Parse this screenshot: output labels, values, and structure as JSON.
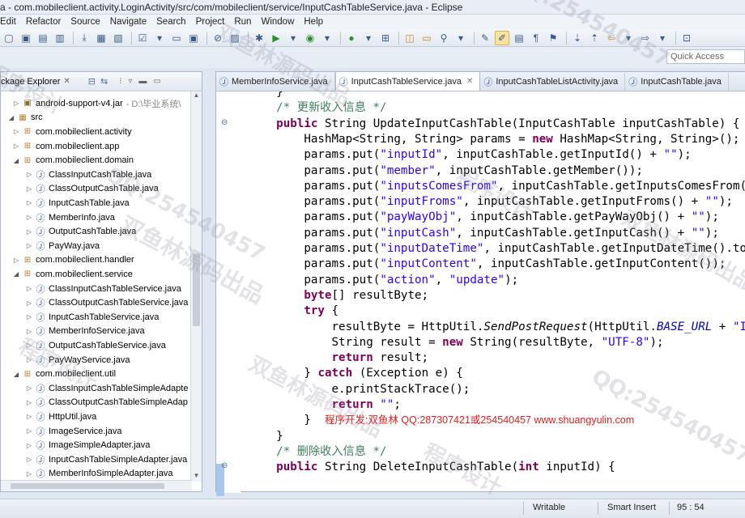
{
  "window": {
    "title": "a - com.mobileclient.activity.LoginActivity/src/com/mobileclient/service/InputCashTableService.java - Eclipse"
  },
  "menu": [
    "Edit",
    "Refactor",
    "Source",
    "Navigate",
    "Search",
    "Project",
    "Run",
    "Window",
    "Help"
  ],
  "toolbar": {
    "quick_access_placeholder": "Quick Access"
  },
  "package_explorer": {
    "title": "ckage Explorer",
    "items": [
      {
        "label": "android-support-v4.jar",
        "suffix": "- D:\\毕业系统\\",
        "type": "jar",
        "depth": 1,
        "twisty": "closed"
      },
      {
        "label": "src",
        "type": "src",
        "depth": 0,
        "twisty": "open"
      },
      {
        "label": "com.mobileclient.activity",
        "type": "pkg",
        "depth": 1,
        "twisty": "closed"
      },
      {
        "label": "com.mobileclient.app",
        "type": "pkg",
        "depth": 1,
        "twisty": "closed"
      },
      {
        "label": "com.mobileclient.domain",
        "type": "pkg",
        "depth": 1,
        "twisty": "open"
      },
      {
        "label": "ClassInputCashTable.java",
        "type": "java",
        "depth": 2,
        "twisty": "closed"
      },
      {
        "label": "ClassOutputCashTable.java",
        "type": "java",
        "depth": 2,
        "twisty": "closed"
      },
      {
        "label": "InputCashTable.java",
        "type": "java",
        "depth": 2,
        "twisty": "closed"
      },
      {
        "label": "MemberInfo.java",
        "type": "java",
        "depth": 2,
        "twisty": "closed"
      },
      {
        "label": "OutputCashTable.java",
        "type": "java",
        "depth": 2,
        "twisty": "closed"
      },
      {
        "label": "PayWay.java",
        "type": "java",
        "depth": 2,
        "twisty": "closed"
      },
      {
        "label": "com.mobileclient.handler",
        "type": "pkg",
        "depth": 1,
        "twisty": "closed"
      },
      {
        "label": "com.mobileclient.service",
        "type": "pkg",
        "depth": 1,
        "twisty": "open"
      },
      {
        "label": "ClassInputCashTableService.java",
        "type": "java",
        "depth": 2,
        "twisty": "closed"
      },
      {
        "label": "ClassOutputCashTableService.java",
        "type": "java",
        "depth": 2,
        "twisty": "closed"
      },
      {
        "label": "InputCashTableService.java",
        "type": "java",
        "depth": 2,
        "twisty": "closed"
      },
      {
        "label": "MemberInfoService.java",
        "type": "java",
        "depth": 2,
        "twisty": "closed"
      },
      {
        "label": "OutputCashTableService.java",
        "type": "java",
        "depth": 2,
        "twisty": "closed"
      },
      {
        "label": "PayWayService.java",
        "type": "java",
        "depth": 2,
        "twisty": "closed"
      },
      {
        "label": "com.mobileclient.util",
        "type": "pkg",
        "depth": 1,
        "twisty": "open"
      },
      {
        "label": "ClassInputCashTableSimpleAdapte",
        "type": "java",
        "depth": 2,
        "twisty": "closed"
      },
      {
        "label": "ClassOutputCashTableSimpleAdap",
        "type": "java",
        "depth": 2,
        "twisty": "closed"
      },
      {
        "label": "HttpUtil.java",
        "type": "java",
        "depth": 2,
        "twisty": "closed"
      },
      {
        "label": "ImageService.java",
        "type": "java",
        "depth": 2,
        "twisty": "closed"
      },
      {
        "label": "ImageSimpleAdapter.java",
        "type": "java",
        "depth": 2,
        "twisty": "closed"
      },
      {
        "label": "InputCashTableSimpleAdapter.java",
        "type": "java",
        "depth": 2,
        "twisty": "closed"
      },
      {
        "label": "MemberInfoSimpleAdapter.java",
        "type": "java",
        "depth": 2,
        "twisty": "closed"
      }
    ]
  },
  "editor": {
    "tabs": [
      {
        "label": "MemberInfoService.java",
        "active": false
      },
      {
        "label": "InputCashTableService.java",
        "active": true
      },
      {
        "label": "InputCashTableListActivity.java",
        "active": false
      },
      {
        "label": "InputCashTable.java",
        "active": false
      }
    ],
    "lines": [
      {
        "indent": "    ",
        "parts": [
          [
            "p",
            "}"
          ]
        ]
      },
      {
        "indent": "    ",
        "parts": [
          [
            "cm",
            "/* 更新收入信息 */"
          ]
        ]
      },
      {
        "indent": "    ",
        "fold": true,
        "parts": [
          [
            "kw",
            "public"
          ],
          [
            "p",
            " String UpdateInputCashTable(InputCashTable inputCashTable) {"
          ]
        ]
      },
      {
        "indent": "        ",
        "parts": [
          [
            "p",
            "HashMap<String, String> params = "
          ],
          [
            "kw",
            "new"
          ],
          [
            "p",
            " HashMap<String, String>();"
          ]
        ]
      },
      {
        "indent": "        ",
        "parts": [
          [
            "p",
            "params.put("
          ],
          [
            "st",
            "\"inputId\""
          ],
          [
            "p",
            ", inputCashTable.getInputId() + "
          ],
          [
            "st",
            "\"\""
          ],
          [
            "p",
            ");"
          ]
        ]
      },
      {
        "indent": "        ",
        "parts": [
          [
            "p",
            "params.put("
          ],
          [
            "st",
            "\"member\""
          ],
          [
            "p",
            ", inputCashTable.getMember());"
          ]
        ]
      },
      {
        "indent": "        ",
        "parts": [
          [
            "p",
            "params.put("
          ],
          [
            "st",
            "\"inputsComesFrom\""
          ],
          [
            "p",
            ", inputCashTable.getInputsComesFrom());"
          ]
        ]
      },
      {
        "indent": "        ",
        "parts": [
          [
            "p",
            "params.put("
          ],
          [
            "st",
            "\"inputFroms\""
          ],
          [
            "p",
            ", inputCashTable.getInputFroms() + "
          ],
          [
            "st",
            "\"\""
          ],
          [
            "p",
            ");"
          ]
        ]
      },
      {
        "indent": "        ",
        "parts": [
          [
            "p",
            "params.put("
          ],
          [
            "st",
            "\"payWayObj\""
          ],
          [
            "p",
            ", inputCashTable.getPayWayObj() + "
          ],
          [
            "st",
            "\"\""
          ],
          [
            "p",
            ");"
          ]
        ]
      },
      {
        "indent": "        ",
        "parts": [
          [
            "p",
            "params.put("
          ],
          [
            "st",
            "\"inputCash\""
          ],
          [
            "p",
            ", inputCashTable.getInputCash() + "
          ],
          [
            "st",
            "\"\""
          ],
          [
            "p",
            ");"
          ]
        ]
      },
      {
        "indent": "        ",
        "parts": [
          [
            "p",
            "params.put("
          ],
          [
            "st",
            "\"inputDateTime\""
          ],
          [
            "p",
            ", inputCashTable.getInputDateTime().toSt"
          ]
        ]
      },
      {
        "indent": "        ",
        "parts": [
          [
            "p",
            "params.put("
          ],
          [
            "st",
            "\"inputContent\""
          ],
          [
            "p",
            ", inputCashTable.getInputContent());"
          ]
        ]
      },
      {
        "indent": "        ",
        "parts": [
          [
            "p",
            "params.put("
          ],
          [
            "st",
            "\"action\""
          ],
          [
            "p",
            ", "
          ],
          [
            "st",
            "\"update\""
          ],
          [
            "p",
            ");"
          ]
        ]
      },
      {
        "indent": "        ",
        "parts": [
          [
            "kw",
            "byte"
          ],
          [
            "p",
            "[] resultByte;"
          ]
        ]
      },
      {
        "indent": "        ",
        "parts": [
          [
            "kw",
            "try"
          ],
          [
            "p",
            " {"
          ]
        ]
      },
      {
        "indent": "            ",
        "parts": [
          [
            "p",
            "resultByte = HttpUtil."
          ],
          [
            "it",
            "SendPostRequest"
          ],
          [
            "p",
            "(HttpUtil."
          ],
          [
            "fd",
            "BASE_URL"
          ],
          [
            "p",
            " + "
          ],
          [
            "st",
            "\"Inp"
          ]
        ]
      },
      {
        "indent": "            ",
        "parts": [
          [
            "p",
            "String result = "
          ],
          [
            "kw",
            "new"
          ],
          [
            "p",
            " String(resultByte, "
          ],
          [
            "st",
            "\"UTF-8\""
          ],
          [
            "p",
            ");"
          ]
        ]
      },
      {
        "indent": "            ",
        "parts": [
          [
            "kw",
            "return"
          ],
          [
            "p",
            " result;"
          ]
        ]
      },
      {
        "indent": "        ",
        "parts": [
          [
            "p",
            "} "
          ],
          [
            "kw",
            "catch"
          ],
          [
            "p",
            " (Exception e) {"
          ]
        ]
      },
      {
        "indent": "            ",
        "parts": [
          [
            "p",
            "e.printStackTrace();"
          ]
        ]
      },
      {
        "indent": "            ",
        "parts": [
          [
            "kw",
            "return"
          ],
          [
            "p",
            " "
          ],
          [
            "st",
            "\"\""
          ],
          [
            "p",
            ";"
          ]
        ]
      },
      {
        "indent": "        ",
        "parts": [
          [
            "p",
            "}  "
          ],
          [
            "wm",
            "程序开发:双鱼林 QQ:287307421或254540457 www.shuangyulin.com"
          ]
        ]
      },
      {
        "indent": "    ",
        "parts": [
          [
            "p",
            "}"
          ]
        ]
      },
      {
        "indent": "    ",
        "parts": [
          [
            "cm",
            "/* 删除收入信息 */"
          ]
        ]
      },
      {
        "indent": "    ",
        "fold": true,
        "parts": [
          [
            "kw",
            "public"
          ],
          [
            "p",
            " String DeleteInputCashTable("
          ],
          [
            "kw",
            "int"
          ],
          [
            "p",
            " inputId) {"
          ]
        ]
      }
    ]
  },
  "status": {
    "writable": "Writable",
    "insert_mode": "Smart Insert",
    "position": "95 : 54"
  },
  "watermark": {
    "text_a": "QQ:254540457",
    "text_b": "双鱼林源码出品",
    "text_c": "程序设计"
  }
}
